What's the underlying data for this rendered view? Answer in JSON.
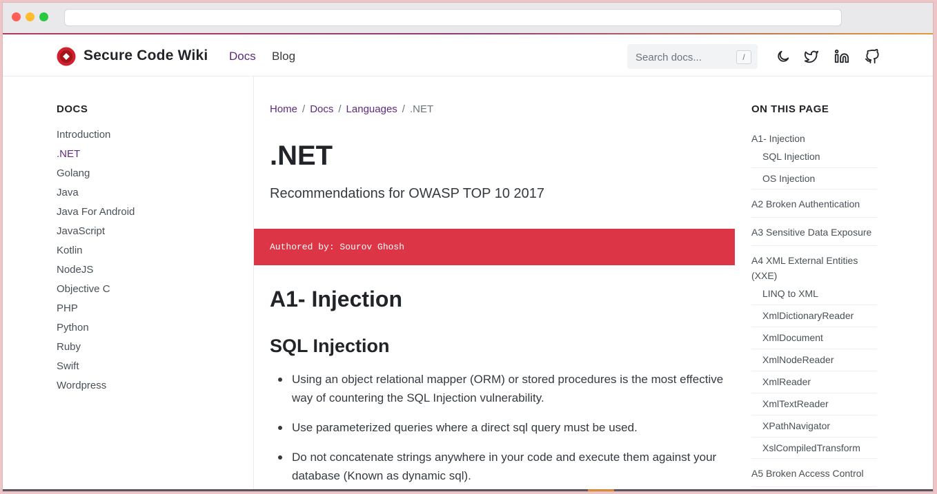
{
  "brand": {
    "name": "Secure Code Wiki",
    "logo_color": "#d0202b"
  },
  "nav": {
    "docs": "Docs",
    "blog": "Blog"
  },
  "search": {
    "placeholder": "Search docs...",
    "shortcut": "/"
  },
  "icons": {
    "theme": "moon-icon",
    "twitter": "twitter-icon",
    "linkedin": "linkedin-icon",
    "github": "github-icon"
  },
  "sidebar": {
    "title": "DOCS",
    "items": [
      "Introduction",
      ".NET",
      "Golang",
      "Java",
      "Java For Android",
      "JavaScript",
      "Kotlin",
      "NodeJS",
      "Objective C",
      "PHP",
      "Python",
      "Ruby",
      "Swift",
      "Wordpress"
    ],
    "active": ".NET"
  },
  "breadcrumb": {
    "home": "Home",
    "docs": "Docs",
    "languages": "Languages",
    "current": ".NET"
  },
  "page": {
    "title": ".NET",
    "lead": "Recommendations for OWASP TOP 10 2017",
    "author": "Authored by: Sourov Ghosh",
    "h2": "A1- Injection",
    "h3": "SQL Injection",
    "bullets": [
      "Using an object relational mapper (ORM) or stored procedures is the most effective way of countering the SQL Injection vulnerability.",
      "Use parameterized queries where a direct sql query must be used.",
      "Do not concatenate strings anywhere in your code and execute them against your database (Known as dynamic sql)."
    ]
  },
  "toc": {
    "title": "ON THIS PAGE",
    "a1": "A1- Injection",
    "a1_subs": [
      "SQL Injection",
      "OS Injection"
    ],
    "a2": "A2 Broken Authentication",
    "a3": "A3 Sensitive Data Exposure",
    "a4": "A4 XML External Entities (XXE)",
    "a4_subs": [
      "LINQ to XML",
      "XmlDictionaryReader",
      "XmlDocument",
      "XmlNodeReader",
      "XmlReader",
      "XmlTextReader",
      "XPathNavigator",
      "XslCompiledTransform"
    ],
    "a5": "A5 Broken Access Control"
  },
  "colors": {
    "accent": "#5e2a7e",
    "author_banner": "#dc3545"
  }
}
